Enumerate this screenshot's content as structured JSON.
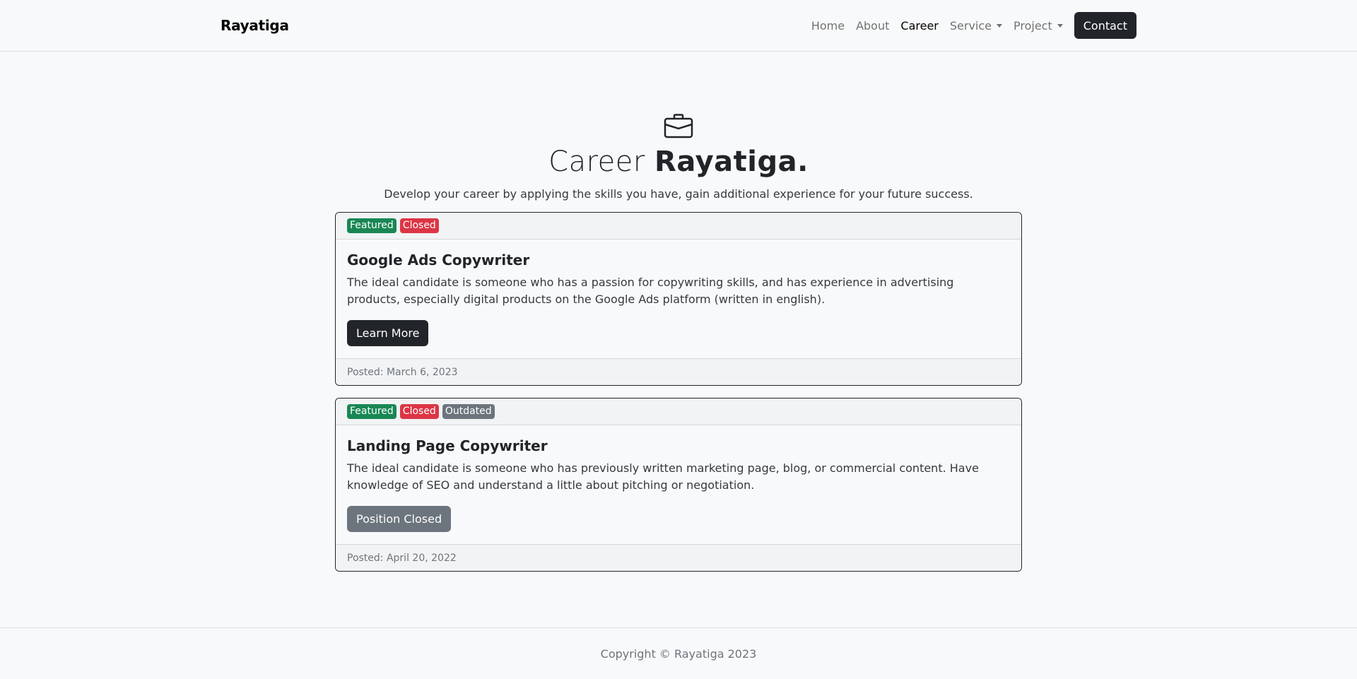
{
  "nav": {
    "brand": "Rayatiga",
    "links": [
      {
        "label": "Home"
      },
      {
        "label": "About"
      },
      {
        "label": "Career"
      },
      {
        "label": "Service"
      },
      {
        "label": "Project"
      }
    ],
    "contact_label": "Contact"
  },
  "hero": {
    "icon": "briefcase-icon",
    "title_light": "Career ",
    "title_bold": "Rayatiga.",
    "subtitle": "Develop your career by applying the skills you have, gain additional experience for your future success."
  },
  "jobs": [
    {
      "badges": [
        "Featured",
        "Closed"
      ],
      "title": "Google Ads Copywriter",
      "description": "The ideal candidate is someone who has a passion for copywriting skills, and has experience in advertising products, especially digital products on the Google Ads platform (written in english).",
      "button_label": "Learn More",
      "posted": "Posted: March 6, 2023"
    },
    {
      "badges": [
        "Featured",
        "Closed",
        "Outdated"
      ],
      "title": "Landing Page Copywriter",
      "description": "The ideal candidate is someone who has previously written marketing page, blog, or commercial content. Have knowledge of SEO and understand a little about pitching or negotiation.",
      "button_label": "Position Closed",
      "posted": "Posted: April 20, 2022"
    }
  ],
  "footer": {
    "copyright": "Copyright © Rayatiga 2023"
  },
  "colors": {
    "featured": "#198754",
    "closed": "#dc3545",
    "outdated": "#6c757d",
    "dark": "#212529"
  }
}
